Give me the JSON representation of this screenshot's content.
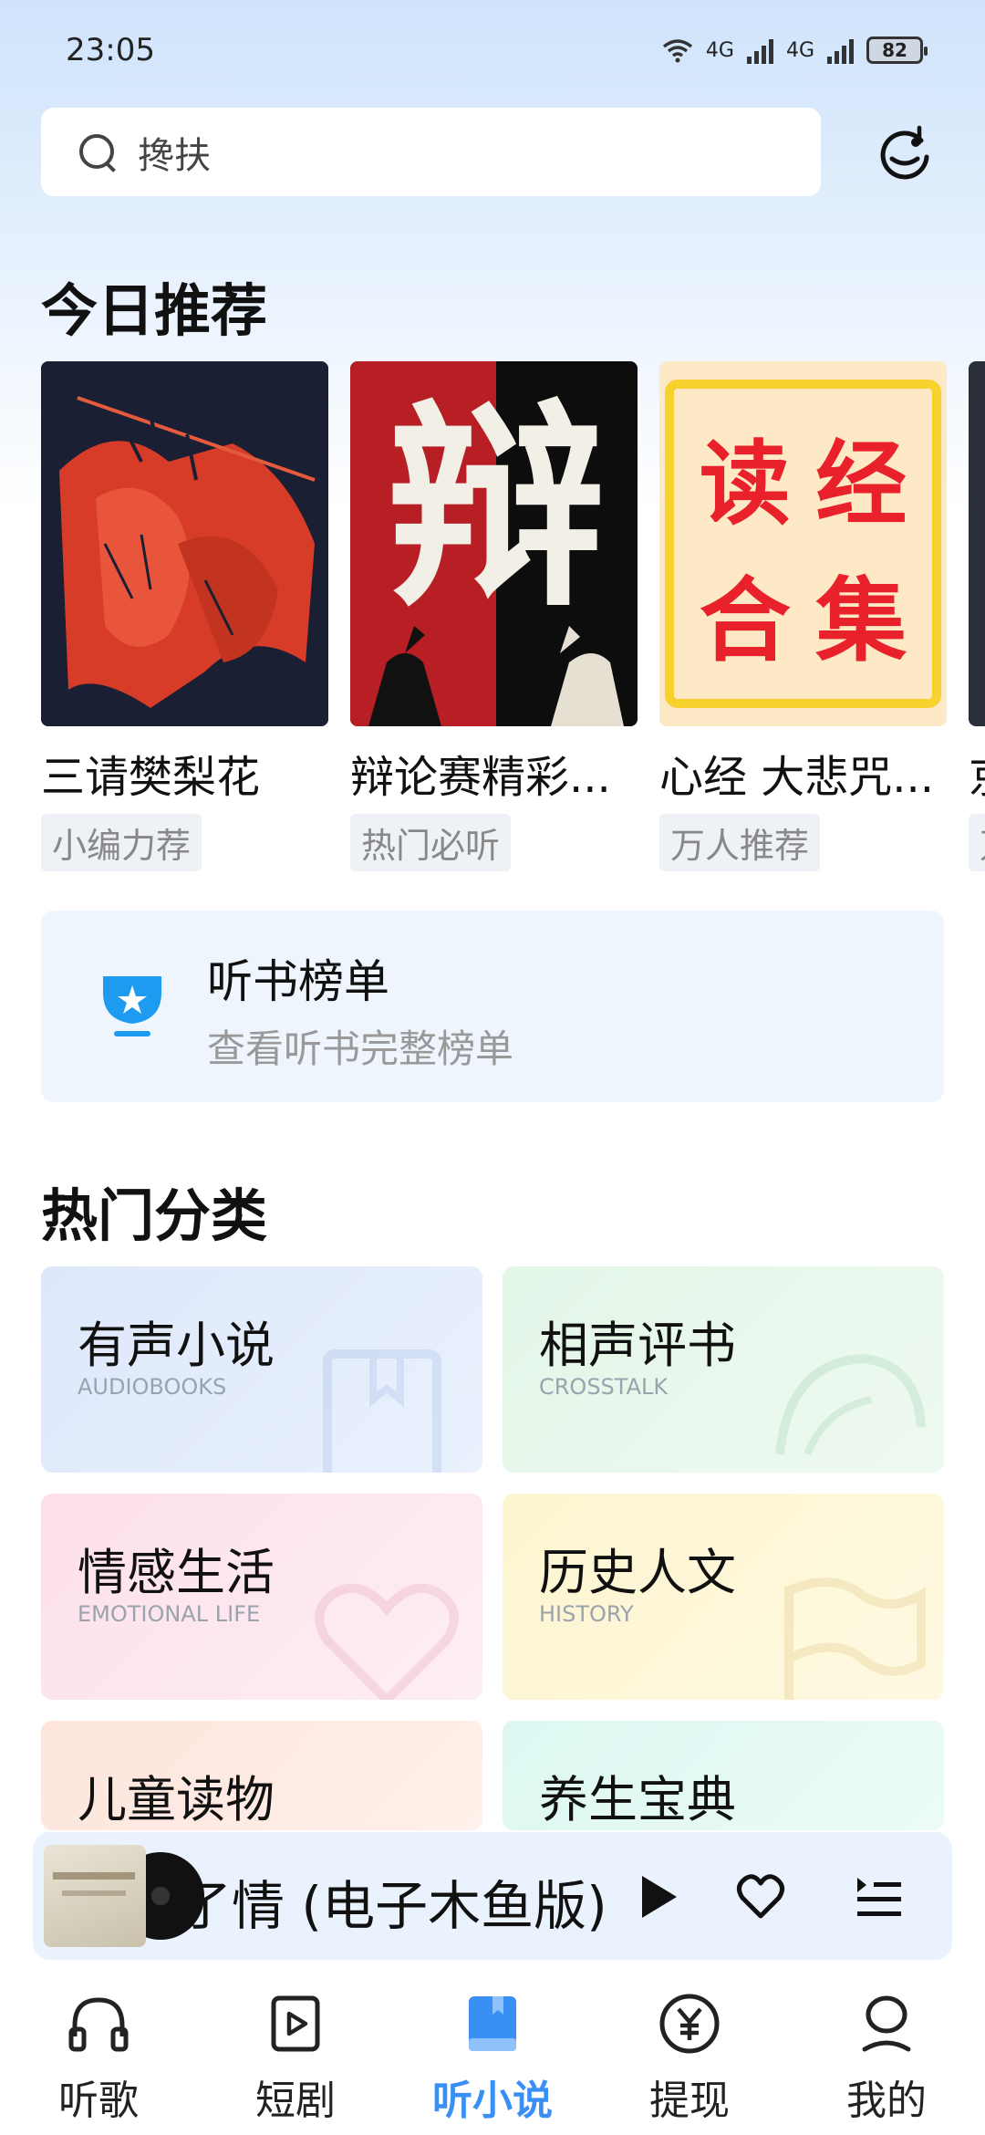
{
  "status_bar": {
    "time": "23:05",
    "net1": "4G",
    "net2": "4G",
    "battery": "82"
  },
  "search": {
    "placeholder": "搀扶"
  },
  "recommend": {
    "title": "今日推荐",
    "items": [
      {
        "title": "三请樊梨花",
        "tag": "小编力荐"
      },
      {
        "title": "辩论赛精彩...",
        "tag": "热门必听"
      },
      {
        "title": "心经 大悲咒...",
        "tag": "万人推荐"
      },
      {
        "title": "京",
        "tag": "万"
      }
    ],
    "cover_text_2": "辩",
    "cover_text_3": [
      "读",
      "经",
      "合",
      "集"
    ]
  },
  "rank": {
    "title": "听书榜单",
    "subtitle": "查看听书完整榜单"
  },
  "categories": {
    "title": "热门分类",
    "items": [
      {
        "name": "有声小说",
        "en": "AUDIOBOOKS"
      },
      {
        "name": "相声评书",
        "en": "CROSSTALK"
      },
      {
        "name": "情感生活",
        "en": "EMOTIONAL LIFE"
      },
      {
        "name": "历史人文",
        "en": "HISTORY"
      },
      {
        "name": "儿童读物",
        "en": ""
      },
      {
        "name": "养生宝典",
        "en": ""
      }
    ]
  },
  "player": {
    "title": "了情 (电子木鱼版)"
  },
  "nav": {
    "items": [
      {
        "label": "听歌"
      },
      {
        "label": "短剧"
      },
      {
        "label": "听小说"
      },
      {
        "label": "提现"
      },
      {
        "label": "我的"
      }
    ]
  },
  "colors": {
    "accent": "#3a8ff5",
    "brand_blue": "#1c9bf0"
  }
}
